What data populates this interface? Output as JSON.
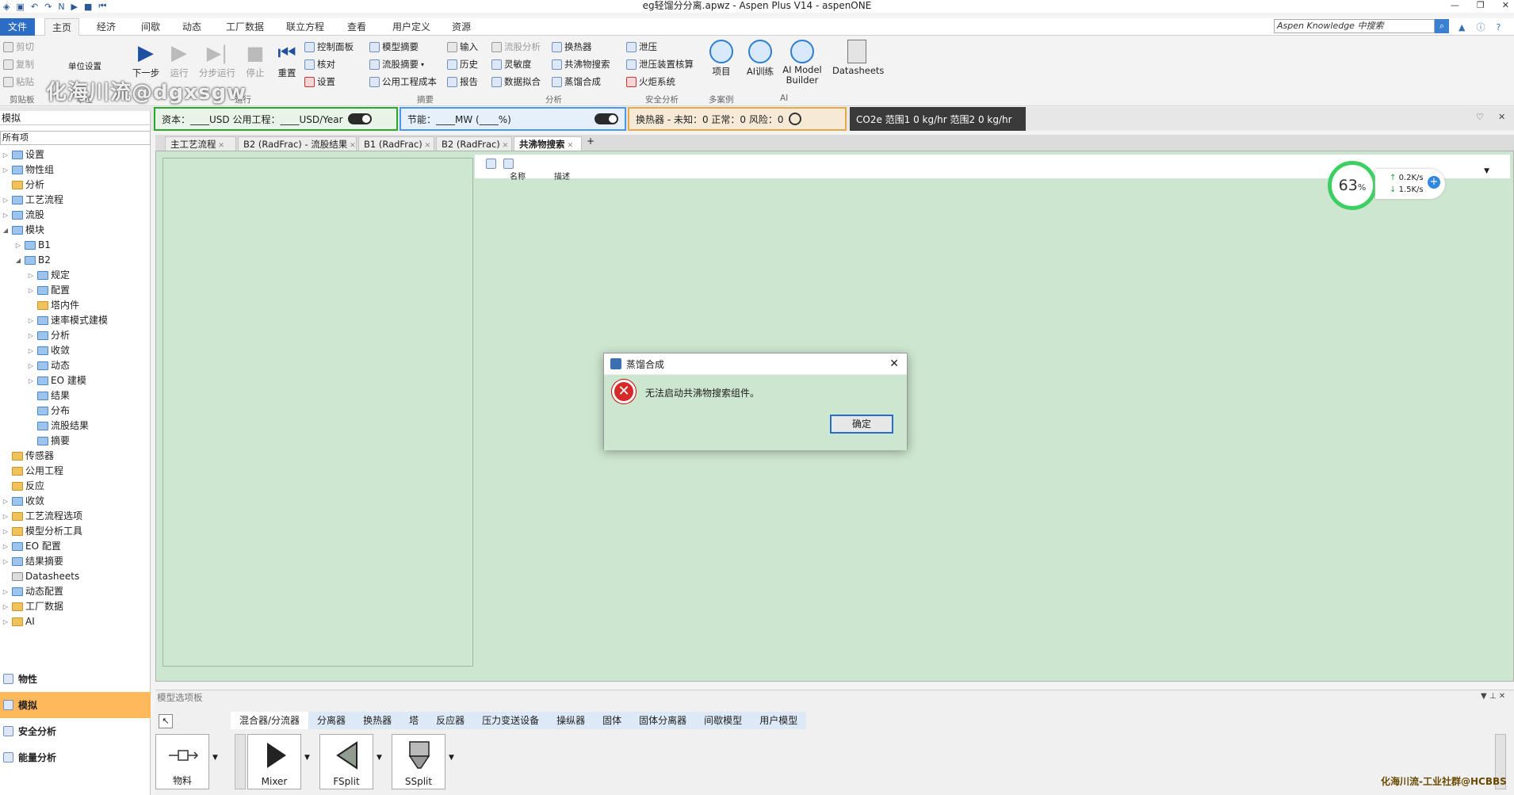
{
  "title_bar": {
    "title": "eg轻馏分分离.apwz - Aspen Plus V14 - aspenONE"
  },
  "menu": {
    "file": "文件",
    "tabs": [
      "主页",
      "经济",
      "间歇",
      "动态",
      "工厂数据",
      "联立方程",
      "查看",
      "用户定义",
      "资源"
    ],
    "active_tab": "主页",
    "search_placeholder": "Aspen Knowledge 中搜索"
  },
  "watermark": "化海川流@dgxsgw",
  "ribbon": {
    "clipboard": {
      "cut": "剪切",
      "copy": "复制",
      "paste": "粘贴",
      "group": "剪贴板"
    },
    "units": {
      "label": "单位设置",
      "group": "单位"
    },
    "run": {
      "next": "下一步",
      "run": "运行",
      "step": "分步运行",
      "stop": "停止",
      "reset": "重置",
      "control_panel": "控制面板",
      "check": "核对",
      "settings": "设置",
      "group": "运行"
    },
    "summary": {
      "model_summary": "模型摘要",
      "stream_summary": "流股摘要",
      "utility_cost": "公用工程成本",
      "input": "输入",
      "history": "历史",
      "report": "报告",
      "group": "摘要"
    },
    "analysis": {
      "stream_analysis": "流股分析",
      "sensitivity": "灵敏度",
      "data_fit": "数据拟合",
      "heat_exchanger": "换热器",
      "azeotrope_search": "共沸物搜索",
      "distillation_synthesis": "蒸馏合成",
      "group": "分析"
    },
    "safety": {
      "relief": "泄压",
      "relief_check": "泄压装置核算",
      "flare": "火炬系统",
      "group": "安全分析"
    },
    "multicase": {
      "project": "项目",
      "group": "多案例"
    },
    "ai": {
      "ai_training": "AI训练",
      "ai_builder": "AI Model Builder",
      "group": "AI"
    },
    "datasheets": "Datasheets"
  },
  "strip": {
    "capital": "资本：____USD  公用工程：____USD/Year",
    "energy": "节能：____MW   (____%)",
    "exchangers": "换热器 - 未知：0   正常：0   风险：0",
    "co2": "CO2e 范围1  0 kg/hr    范围2  0 kg/hr"
  },
  "nav": {
    "header": "模拟",
    "filter": "所有项",
    "tree": [
      {
        "label": "设置",
        "level": 0,
        "exp": "▷",
        "icon": "b"
      },
      {
        "label": "物性组",
        "level": 0,
        "exp": "▷",
        "icon": "b"
      },
      {
        "label": "分析",
        "level": 0,
        "exp": "",
        "icon": "y"
      },
      {
        "label": "工艺流程",
        "level": 0,
        "exp": "▷",
        "icon": "b"
      },
      {
        "label": "流股",
        "level": 0,
        "exp": "▷",
        "icon": "b"
      },
      {
        "label": "模块",
        "level": 0,
        "exp": "◢",
        "icon": "b"
      },
      {
        "label": "B1",
        "level": 1,
        "exp": "▷",
        "icon": "b"
      },
      {
        "label": "B2",
        "level": 1,
        "exp": "◢",
        "icon": "b"
      },
      {
        "label": "规定",
        "level": 2,
        "exp": "▷",
        "icon": "b"
      },
      {
        "label": "配置",
        "level": 2,
        "exp": "▷",
        "icon": "b"
      },
      {
        "label": "塔内件",
        "level": 2,
        "exp": "",
        "icon": "y"
      },
      {
        "label": "速率模式建模",
        "level": 2,
        "exp": "▷",
        "icon": "b"
      },
      {
        "label": "分析",
        "level": 2,
        "exp": "▷",
        "icon": "b"
      },
      {
        "label": "收敛",
        "level": 2,
        "exp": "▷",
        "icon": "b"
      },
      {
        "label": "动态",
        "level": 2,
        "exp": "▷",
        "icon": "b"
      },
      {
        "label": "EO 建模",
        "level": 2,
        "exp": "▷",
        "icon": "b"
      },
      {
        "label": "结果",
        "level": 2,
        "exp": "",
        "icon": "b"
      },
      {
        "label": "分布",
        "level": 2,
        "exp": "",
        "icon": "b"
      },
      {
        "label": "流股结果",
        "level": 2,
        "exp": "",
        "icon": "b"
      },
      {
        "label": "摘要",
        "level": 2,
        "exp": "",
        "icon": "b"
      },
      {
        "label": "传感器",
        "level": 0,
        "exp": "",
        "icon": "y"
      },
      {
        "label": "公用工程",
        "level": 0,
        "exp": "",
        "icon": "y"
      },
      {
        "label": "反应",
        "level": 0,
        "exp": "",
        "icon": "y"
      },
      {
        "label": "收敛",
        "level": 0,
        "exp": "▷",
        "icon": "b"
      },
      {
        "label": "工艺流程选项",
        "level": 0,
        "exp": "▷",
        "icon": "y"
      },
      {
        "label": "模型分析工具",
        "level": 0,
        "exp": "▷",
        "icon": "y"
      },
      {
        "label": "EO 配置",
        "level": 0,
        "exp": "▷",
        "icon": "b"
      },
      {
        "label": "结果摘要",
        "level": 0,
        "exp": "▷",
        "icon": "b"
      },
      {
        "label": "Datasheets",
        "level": 0,
        "exp": "",
        "icon": "g"
      },
      {
        "label": "动态配置",
        "level": 0,
        "exp": "▷",
        "icon": "b"
      },
      {
        "label": "工厂数据",
        "level": 0,
        "exp": "▷",
        "icon": "y"
      },
      {
        "label": "AI",
        "level": 0,
        "exp": "▷",
        "icon": "y"
      }
    ],
    "bottom": [
      {
        "label": "物性",
        "active": false
      },
      {
        "label": "模拟",
        "active": true
      },
      {
        "label": "安全分析",
        "active": false
      },
      {
        "label": "能量分析",
        "active": false
      }
    ]
  },
  "doc_tabs": [
    {
      "label": "主工艺流程",
      "active": false
    },
    {
      "label": "B2 (RadFrac) - 流股结果",
      "active": false
    },
    {
      "label": "B1 (RadFrac)",
      "active": false
    },
    {
      "label": "B2 (RadFrac)",
      "active": false
    },
    {
      "label": "共沸物搜索",
      "active": true
    }
  ],
  "doc": {
    "col_name": "名称",
    "col_desc": "描述"
  },
  "gauge": {
    "percent": "63",
    "up": "0.2K/s",
    "down": "1.5K/s"
  },
  "dialog": {
    "title": "蒸馏合成",
    "message": "无法启动共沸物搜索组件。",
    "ok": "确定"
  },
  "palette": {
    "header": "模型选项板",
    "tabs": [
      "混合器/分流器",
      "分离器",
      "换热器",
      "塔",
      "反应器",
      "压力变送设备",
      "操纵器",
      "固体",
      "固体分离器",
      "间歇模型",
      "用户模型"
    ],
    "active_tab": "混合器/分流器",
    "items": [
      "物料",
      "Mixer",
      "FSplit",
      "SSplit"
    ]
  },
  "credit": "化海川流-工业社群@HCBBS"
}
